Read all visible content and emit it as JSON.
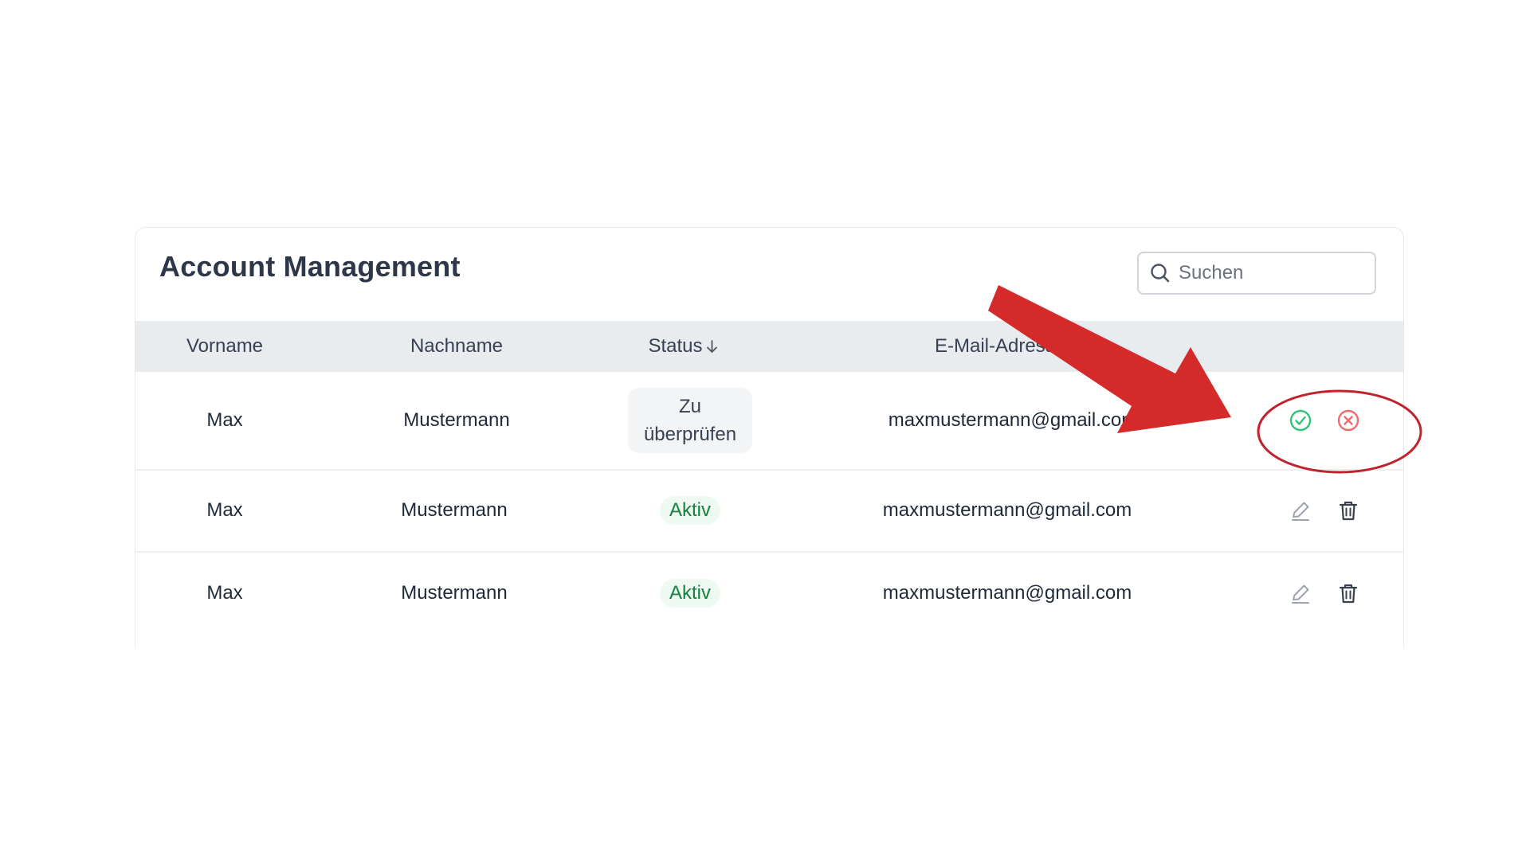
{
  "header": {
    "title": "Account Management"
  },
  "search": {
    "placeholder": "Suchen",
    "value": ""
  },
  "table": {
    "columns": [
      {
        "key": "vorname",
        "label": "Vorname"
      },
      {
        "key": "nachname",
        "label": "Nachname"
      },
      {
        "key": "status",
        "label": "Status",
        "sort_icon": "arrow-down-icon"
      },
      {
        "key": "email",
        "label": "E-Mail-Adresse"
      }
    ],
    "rows": [
      {
        "vorname": "Max",
        "nachname": "Mustermann",
        "status": "Zu überprüfen",
        "status_type": "review",
        "email": "maxmustermann@gmail.com",
        "actions": [
          "check-circle-icon",
          "x-circle-icon"
        ]
      },
      {
        "vorname": "Max",
        "nachname": "Mustermann",
        "status": "Aktiv",
        "status_type": "active",
        "email": "maxmustermann@gmail.com",
        "actions": [
          "pencil-icon",
          "trash-icon"
        ]
      },
      {
        "vorname": "Max",
        "nachname": "Mustermann",
        "status": "Aktiv",
        "status_type": "active",
        "email": "maxmustermann@gmail.com",
        "actions": [
          "pencil-icon",
          "trash-icon"
        ]
      }
    ]
  },
  "colors": {
    "approve": "#34c17a",
    "reject": "#f26b6b",
    "active_text": "#15803d",
    "active_bg": "#eefaf1",
    "annotation": "#d42a2a",
    "header_bg": "#e9ecef"
  },
  "annotation": {
    "arrow": "arrow-annotation",
    "circle": "highlight-circle-annotation"
  }
}
